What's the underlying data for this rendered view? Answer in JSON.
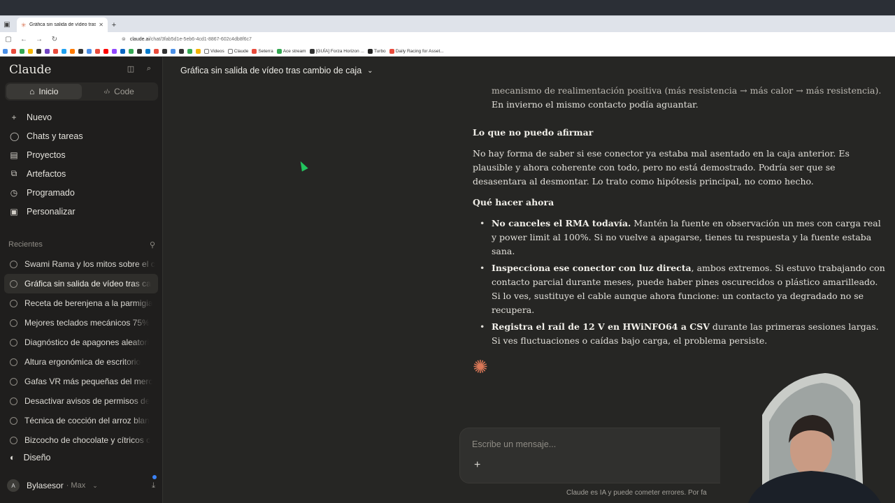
{
  "browser": {
    "tab_title": "Gráfica sin salida de vídeo tras c",
    "url_host": "claude.ai",
    "url_path": "/chat/3fab5d1e-5eb6-4cd1-8867-602c4db8f6c7",
    "bookmarks": [
      "Videos",
      "Claude",
      "Seterra",
      "Ace stream",
      "[GUÍA] Forza Horizon ...",
      "Turbo",
      "Daily Racing for Asset..."
    ]
  },
  "sidebar": {
    "brand": "Claude",
    "modes": [
      {
        "label": "Inicio"
      },
      {
        "label": "Code"
      }
    ],
    "nav": [
      {
        "label": "Nuevo"
      },
      {
        "label": "Chats y tareas"
      },
      {
        "label": "Proyectos"
      },
      {
        "label": "Artefactos"
      },
      {
        "label": "Programado"
      },
      {
        "label": "Personalizar"
      }
    ],
    "recents_label": "Recientes",
    "recents": [
      "Swami Rama y los mitos sobre el c",
      "Gráfica sin salida de vídeo tras ca",
      "Receta de berenjena a la parmigia",
      "Mejores teclados mecánicos 75%",
      "Diagnóstico de apagones aleatori",
      "Altura ergonómica de escritorio",
      "Gafas VR más pequeñas del merc",
      "Desactivar avisos de permisos de",
      "Técnica de cocción del arroz blan",
      "Bizcocho de chocolate y cítricos c"
    ],
    "design_label": "Diseño",
    "user": {
      "initial": "A",
      "name": "Bylasesor",
      "plan": "· Max"
    }
  },
  "chat": {
    "title": "Gráfica sin salida de vídeo tras cambio de caja",
    "prev_line_1": "mecanismo de realimentación positiva (más resistencia → más calor → más resistencia).",
    "prev_line_2": "En invierno el mismo contacto podía aguantar.",
    "section1_title": "Lo que no puedo afirmar",
    "section1_body": "No hay forma de saber si ese conector ya estaba mal asentado en la caja anterior. Es plausible y ahora coherente con todo, pero no está demostrado. Podría ser que se desasentara al desmontar. Lo trato como hipótesis principal, no como hecho.",
    "section2_title": "Qué hacer ahora",
    "bullets": [
      {
        "bold": "No canceles el RMA todavía.",
        "rest": " Mantén la fuente en observación un mes con carga real y power limit al 100%. Si no vuelve a apagarse, tienes tu respuesta y la fuente estaba sana."
      },
      {
        "bold": "Inspecciona ese conector con luz directa",
        "rest": ", ambos extremos. Si estuvo trabajando con contacto parcial durante meses, puede haber pines oscurecidos o plástico amarilleado. Si lo ves, sustituye el cable aunque ahora funcione: un contacto ya degradado no se recupera."
      },
      {
        "bold": "Registra el raíl de 12 V en HWiNFO64 a CSV",
        "rest": " durante las primeras sesiones largas. Si ves fluctuaciones o caídas bajo carga, el problema persiste."
      }
    ],
    "composer_placeholder": "Escribe un mensaje...",
    "disclaimer": "Claude es IA y puede cometer errores. Por fa"
  }
}
